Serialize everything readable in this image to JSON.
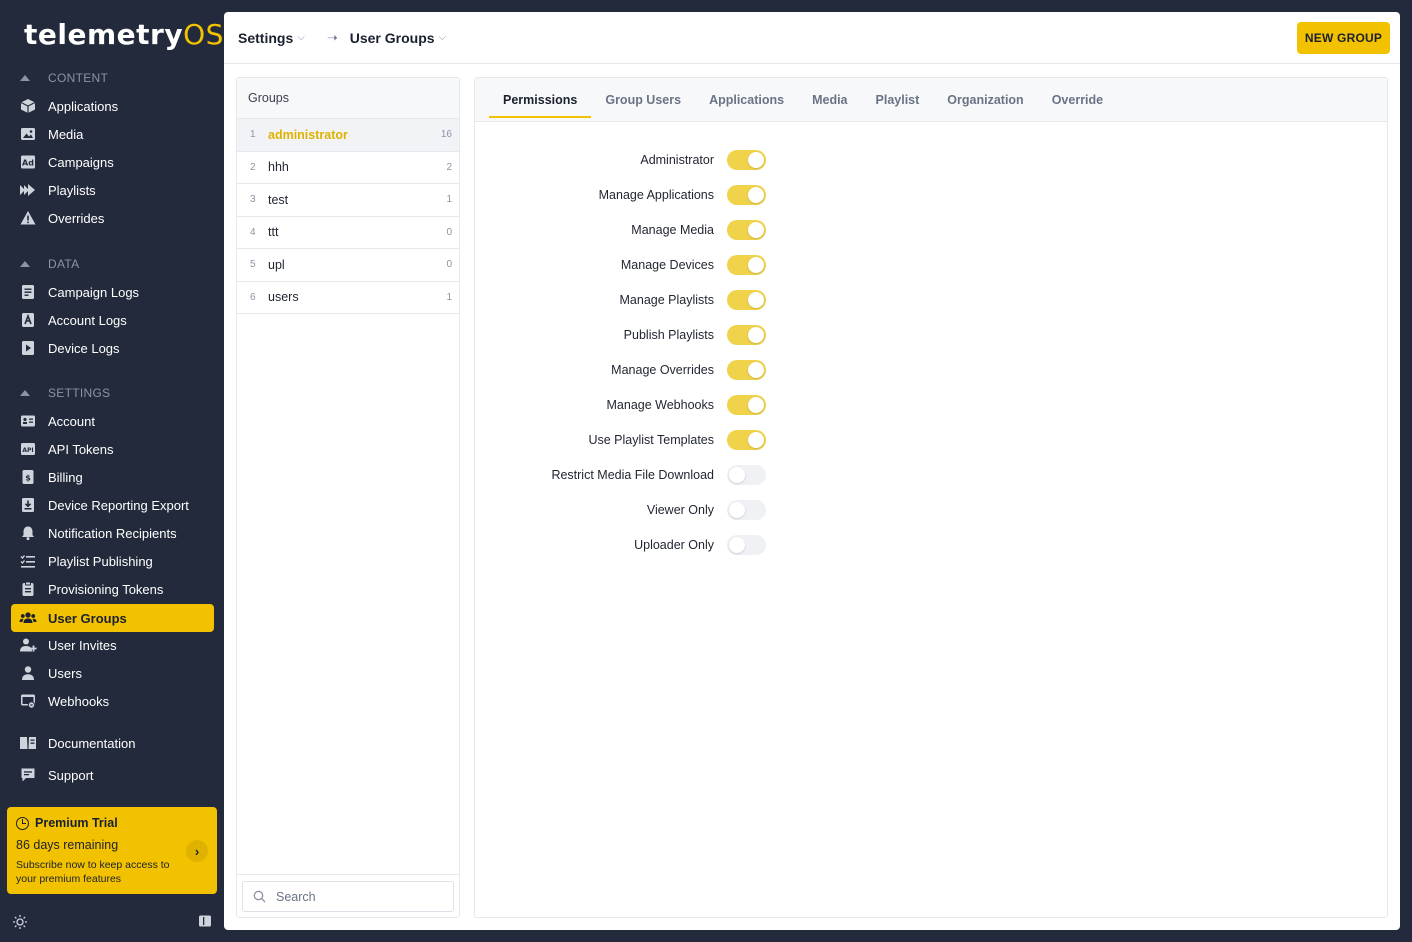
{
  "app": {
    "logo_main": "telemetry",
    "logo_accent": "OS"
  },
  "sidebar": {
    "sections": [
      {
        "title": "CONTENT",
        "items": [
          {
            "label": "Applications",
            "icon": "cube-icon"
          },
          {
            "label": "Media",
            "icon": "image-icon"
          },
          {
            "label": "Campaigns",
            "icon": "ad-icon"
          },
          {
            "label": "Playlists",
            "icon": "playlists-icon"
          },
          {
            "label": "Overrides",
            "icon": "warning-icon"
          }
        ]
      },
      {
        "title": "DATA",
        "items": [
          {
            "label": "Campaign Logs",
            "icon": "log-icon"
          },
          {
            "label": "Account Logs",
            "icon": "account-log-icon"
          },
          {
            "label": "Device Logs",
            "icon": "device-log-icon"
          }
        ]
      },
      {
        "title": "SETTINGS",
        "items": [
          {
            "label": "Account",
            "icon": "account-card-icon"
          },
          {
            "label": "API Tokens",
            "icon": "api-icon"
          },
          {
            "label": "Billing",
            "icon": "billing-icon"
          },
          {
            "label": "Device Reporting Export",
            "icon": "download-icon"
          },
          {
            "label": "Notification Recipients",
            "icon": "bell-icon"
          },
          {
            "label": "Playlist Publishing",
            "icon": "checklist-icon"
          },
          {
            "label": "Provisioning Tokens",
            "icon": "clipboard-icon"
          },
          {
            "label": "User Groups",
            "icon": "users-group-icon",
            "active": true
          },
          {
            "label": "User Invites",
            "icon": "user-add-icon"
          },
          {
            "label": "Users",
            "icon": "user-icon"
          },
          {
            "label": "Webhooks",
            "icon": "webhook-icon"
          }
        ]
      }
    ],
    "extra": [
      {
        "label": "Documentation",
        "icon": "book-icon"
      },
      {
        "label": "Support",
        "icon": "chat-icon"
      }
    ],
    "premium": {
      "title": "Premium Trial",
      "days": "86 days remaining",
      "subtitle": "Subscribe now to keep access to your premium features"
    }
  },
  "header": {
    "crumb1": "Settings",
    "crumb2": "User Groups",
    "new_group": "NEW GROUP"
  },
  "groups": {
    "title": "Groups",
    "items": [
      {
        "num": "1",
        "name": "administrator",
        "count": "16",
        "selected": true
      },
      {
        "num": "2",
        "name": "hhh",
        "count": "2"
      },
      {
        "num": "3",
        "name": "test",
        "count": "1"
      },
      {
        "num": "4",
        "name": "ttt",
        "count": "0"
      },
      {
        "num": "5",
        "name": "upl",
        "count": "0"
      },
      {
        "num": "6",
        "name": "users",
        "count": "1"
      }
    ],
    "search_placeholder": "Search"
  },
  "tabs": [
    "Permissions",
    "Group Users",
    "Applications",
    "Media",
    "Playlist",
    "Organization",
    "Override"
  ],
  "permissions": [
    {
      "label": "Administrator",
      "on": true
    },
    {
      "label": "Manage Applications",
      "on": true
    },
    {
      "label": "Manage Media",
      "on": true
    },
    {
      "label": "Manage Devices",
      "on": true
    },
    {
      "label": "Manage Playlists",
      "on": true
    },
    {
      "label": "Publish Playlists",
      "on": true
    },
    {
      "label": "Manage Overrides",
      "on": true
    },
    {
      "label": "Manage Webhooks",
      "on": true
    },
    {
      "label": "Use Playlist Templates",
      "on": true
    },
    {
      "label": "Restrict Media File Download",
      "on": false
    },
    {
      "label": "Viewer Only",
      "on": false
    },
    {
      "label": "Uploader Only",
      "on": false
    }
  ],
  "colors": {
    "accent": "#f2c200",
    "sidebar_bg": "#232a3b",
    "toggle_on": "#f0d34a",
    "toggle_off": "#f0f1f5"
  }
}
